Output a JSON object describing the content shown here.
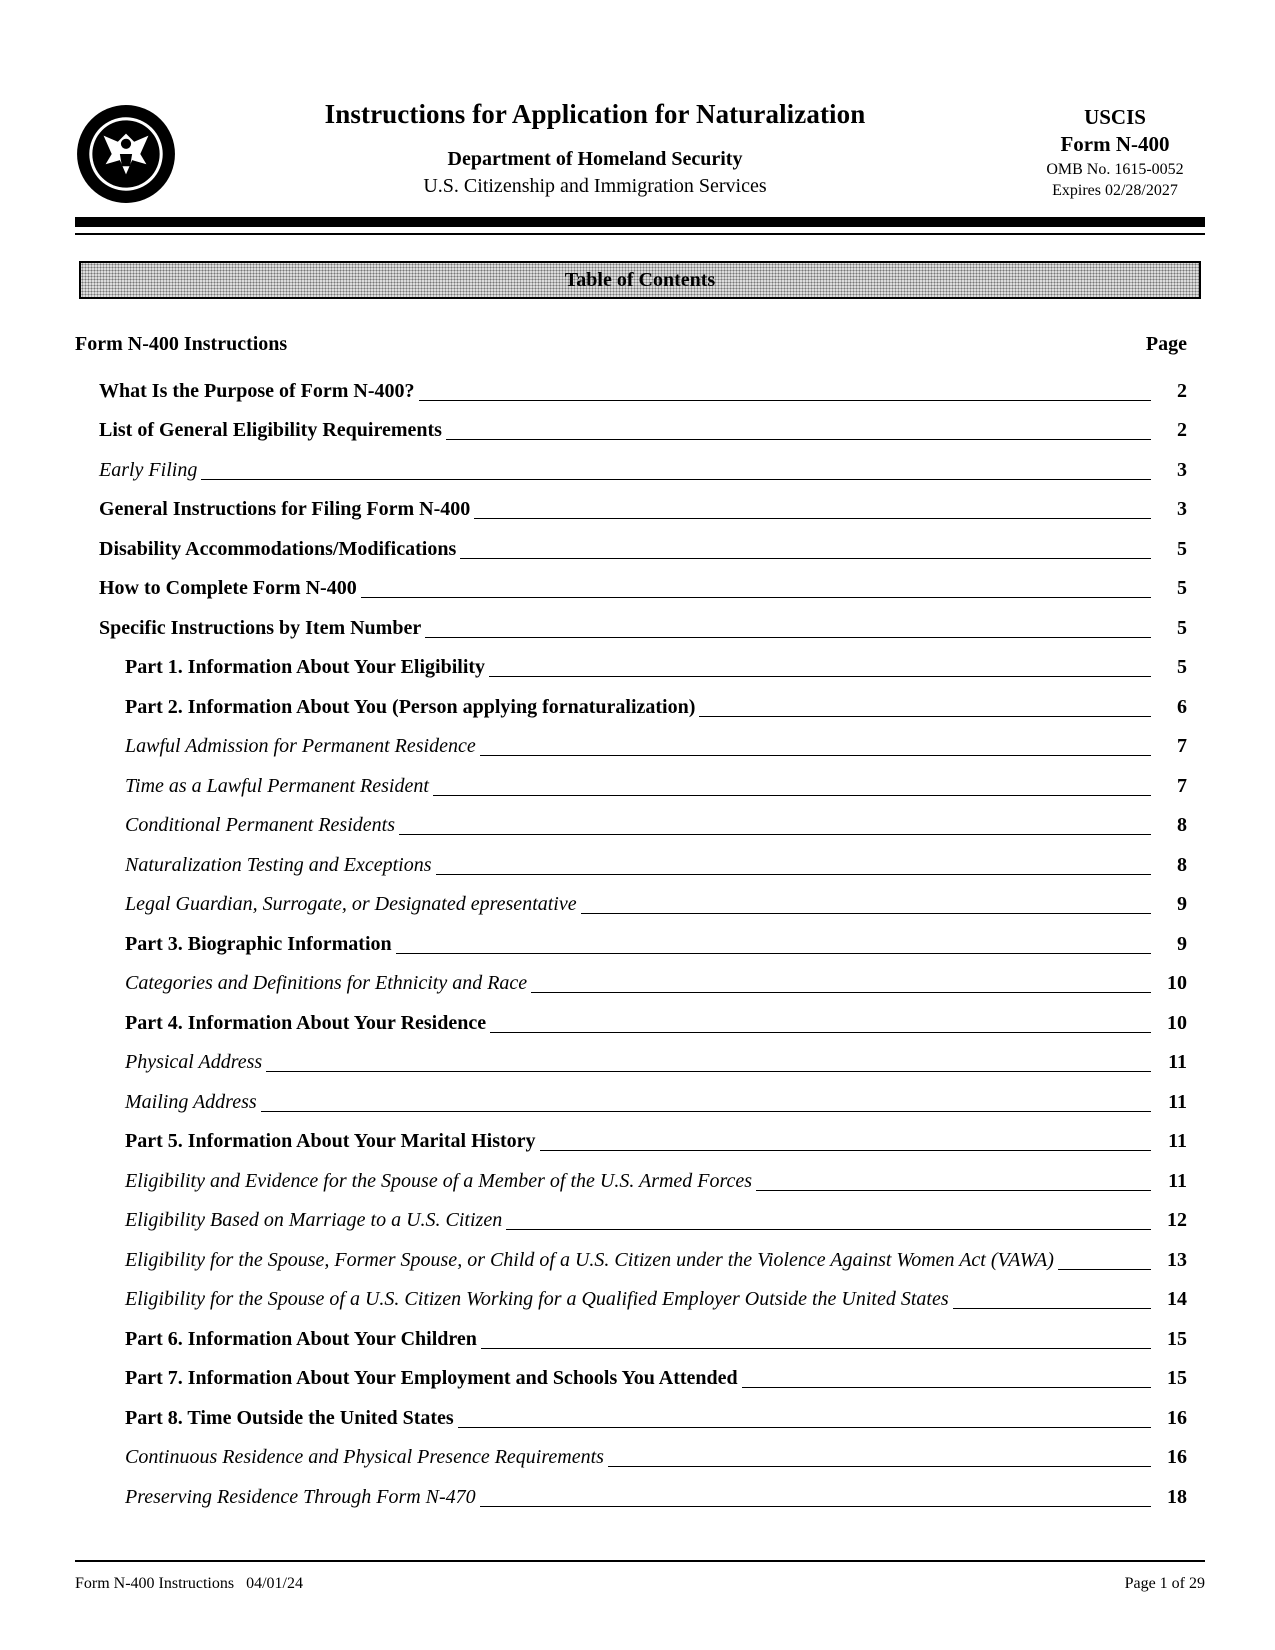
{
  "header": {
    "seal_icon": "dhs-seal-icon",
    "title": "Instructions for Application for Naturalization",
    "department": "Department of Homeland Security",
    "agency": "U.S. Citizenship and Immigration Services",
    "agency_short": "USCIS",
    "form_number": "Form N-400",
    "omb": "OMB No. 1615-0052",
    "expires": "Expires 02/28/2027"
  },
  "toc": {
    "banner": "Table of Contents",
    "section_title": "Form N-400 Instructions",
    "page_header": "Page",
    "entries": [
      {
        "label": "What Is the Purpose of Form N-400?",
        "page": "2",
        "level": 1,
        "style": "bold"
      },
      {
        "label": "List of General Eligibility Requirements",
        "page": "2",
        "level": 1,
        "style": "bold"
      },
      {
        "label": "Early Filing",
        "page": "3",
        "level": 1,
        "style": "italic"
      },
      {
        "label": "General Instructions for Filing Form N-400",
        "page": "3",
        "level": 1,
        "style": "bold"
      },
      {
        "label": "Disability Accommodations/Modifications",
        "page": "5",
        "level": 1,
        "style": "bold"
      },
      {
        "label": "How to Complete Form N-400",
        "page": "5",
        "level": 1,
        "style": "bold"
      },
      {
        "label": "Specific Instructions by Item Number",
        "page": "5",
        "level": 1,
        "style": "bold"
      },
      {
        "label": "Part 1. Information About Your Eligibility",
        "page": "5",
        "level": 2,
        "style": "bold"
      },
      {
        "label": "Part 2. Information About You (Person applying fornaturalization)",
        "page": "6",
        "level": 2,
        "style": "bold"
      },
      {
        "label": "Lawful Admission for Permanent Residence",
        "page": "7",
        "level": 2,
        "style": "italic"
      },
      {
        "label": "Time as a Lawful Permanent Resident",
        "page": "7",
        "level": 2,
        "style": "italic"
      },
      {
        "label": "Conditional Permanent Residents",
        "page": "8",
        "level": 2,
        "style": "italic"
      },
      {
        "label": "Naturalization Testing and Exceptions",
        "page": "8",
        "level": 2,
        "style": "italic"
      },
      {
        "label": "Legal Guardian, Surrogate, or Designated epresentative",
        "page": "9",
        "level": 2,
        "style": "italic"
      },
      {
        "label": "Part 3. Biographic Information",
        "page": "9",
        "level": 2,
        "style": "bold"
      },
      {
        "label": "Categories and Definitions for Ethnicity and Race",
        "page": "10",
        "level": 2,
        "style": "italic"
      },
      {
        "label": "Part 4. Information About Your Residence",
        "page": "10",
        "level": 2,
        "style": "bold"
      },
      {
        "label": "Physical Address",
        "page": "11",
        "level": 2,
        "style": "italic"
      },
      {
        "label": "Mailing Address",
        "page": "11",
        "level": 2,
        "style": "italic"
      },
      {
        "label": "Part 5. Information About Your Marital History",
        "page": "11",
        "level": 2,
        "style": "bold"
      },
      {
        "label": "Eligibility and Evidence for the Spouse of a Member of the U.S. Armed Forces",
        "page": "11",
        "level": 2,
        "style": "italic"
      },
      {
        "label": "Eligibility Based on Marriage to a U.S. Citizen",
        "page": "12",
        "level": 2,
        "style": "italic"
      },
      {
        "label": "Eligibility for the Spouse, Former Spouse, or Child of a U.S. Citizen under the Violence Against Women Act (VAWA)",
        "page": "13",
        "level": 2,
        "style": "italic"
      },
      {
        "label": "Eligibility for the Spouse of a U.S. Citizen Working for a Qualified Employer Outside the United States",
        "page": "14",
        "level": 2,
        "style": "italic"
      },
      {
        "label": "Part 6. Information About Your Children",
        "page": "15",
        "level": 2,
        "style": "bold"
      },
      {
        "label": "Part 7. Information About Your Employment and Schools You Attended",
        "page": "15",
        "level": 2,
        "style": "bold"
      },
      {
        "label": "Part 8. Time Outside the United States",
        "page": "16",
        "level": 2,
        "style": "bold"
      },
      {
        "label": "Continuous Residence and Physical Presence Requirements",
        "page": "16",
        "level": 2,
        "style": "italic"
      },
      {
        "label": "Preserving Residence Through Form N-470",
        "page": "18",
        "level": 2,
        "style": "italic"
      }
    ]
  },
  "footer": {
    "form_edition": "Form N-400 Instructions   04/01/24",
    "page_info": "Page 1 of 29"
  }
}
